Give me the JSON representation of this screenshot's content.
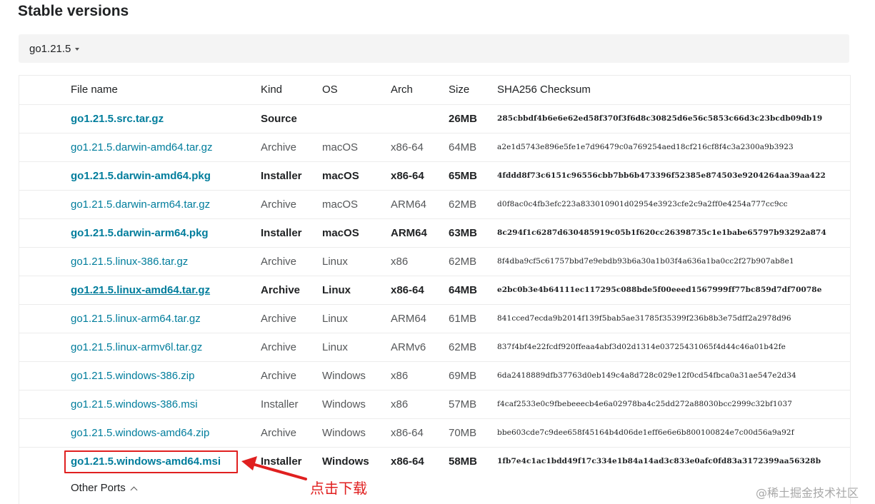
{
  "heading": "Stable versions",
  "version_selector": {
    "value": "go1.21.5"
  },
  "table": {
    "headers": {
      "file": "File name",
      "kind": "Kind",
      "os": "OS",
      "arch": "Arch",
      "size": "Size",
      "checksum": "SHA256 Checksum"
    },
    "rows": [
      {
        "file": "go1.21.5.src.tar.gz",
        "kind": "Source",
        "os": "",
        "arch": "",
        "size": "26MB",
        "checksum": "285cbbdf4b6e6e62ed58f370f3f6d8c30825d6e56c5853c66d3c23bcdb09db19"
      },
      {
        "file": "go1.21.5.darwin-amd64.tar.gz",
        "kind": "Archive",
        "os": "macOS",
        "arch": "x86-64",
        "size": "64MB",
        "checksum": "a2e1d5743e896e5fe1e7d96479c0a769254aed18cf216cf8f4c3a2300a9b3923"
      },
      {
        "file": "go1.21.5.darwin-amd64.pkg",
        "kind": "Installer",
        "os": "macOS",
        "arch": "x86-64",
        "size": "65MB",
        "checksum": "4fddd8f73c6151c96556cbb7bb6b473396f52385e874503e9204264aa39aa422"
      },
      {
        "file": "go1.21.5.darwin-arm64.tar.gz",
        "kind": "Archive",
        "os": "macOS",
        "arch": "ARM64",
        "size": "62MB",
        "checksum": "d0f8ac0c4fb3efc223a833010901d02954e3923cfe2c9a2ff0e4254a777cc9cc"
      },
      {
        "file": "go1.21.5.darwin-arm64.pkg",
        "kind": "Installer",
        "os": "macOS",
        "arch": "ARM64",
        "size": "63MB",
        "checksum": "8c294f1c6287d630485919c05b1f620cc26398735c1e1babe65797b93292a874"
      },
      {
        "file": "go1.21.5.linux-386.tar.gz",
        "kind": "Archive",
        "os": "Linux",
        "arch": "x86",
        "size": "62MB",
        "checksum": "8f4dba9cf5c61757bbd7e9ebdb93b6a30a1b03f4a636a1ba0cc2f27b907ab8e1"
      },
      {
        "file": "go1.21.5.linux-amd64.tar.gz",
        "kind": "Archive",
        "os": "Linux",
        "arch": "x86-64",
        "size": "64MB",
        "checksum": "e2bc0b3e4b64111ec117295c088bde5f00eeed1567999ff77bc859d7df70078e"
      },
      {
        "file": "go1.21.5.linux-arm64.tar.gz",
        "kind": "Archive",
        "os": "Linux",
        "arch": "ARM64",
        "size": "61MB",
        "checksum": "841cced7ecda9b2014f139f5bab5ae31785f35399f236b8b3e75dff2a2978d96"
      },
      {
        "file": "go1.21.5.linux-armv6l.tar.gz",
        "kind": "Archive",
        "os": "Linux",
        "arch": "ARMv6",
        "size": "62MB",
        "checksum": "837f4bf4e22fcdf920ffeaa4abf3d02d1314e03725431065f4d44c46a01b42fe"
      },
      {
        "file": "go1.21.5.windows-386.zip",
        "kind": "Archive",
        "os": "Windows",
        "arch": "x86",
        "size": "69MB",
        "checksum": "6da2418889dfb37763d0eb149c4a8d728c029e12f0cd54fbca0a31ae547e2d34"
      },
      {
        "file": "go1.21.5.windows-386.msi",
        "kind": "Installer",
        "os": "Windows",
        "arch": "x86",
        "size": "57MB",
        "checksum": "f4caf2533e0c9fbebeeecb4e6a02978ba4c25dd272a88030bcc2999c32bf1037"
      },
      {
        "file": "go1.21.5.windows-amd64.zip",
        "kind": "Archive",
        "os": "Windows",
        "arch": "x86-64",
        "size": "70MB",
        "checksum": "bbe603cde7c9dee658f45164b4d06de1eff6e6e6b800100824e7c00d56a9a92f"
      },
      {
        "file": "go1.21.5.windows-amd64.msi",
        "kind": "Installer",
        "os": "Windows",
        "arch": "x86-64",
        "size": "58MB",
        "checksum": "1fb7e4c1ac1bdd49f17c334e1b84a14ad3c833e0afc0fd83a3172399aa56328b"
      }
    ]
  },
  "other_ports_label": "Other Ports",
  "annotation": {
    "text": "点击下载",
    "color": "#e02020"
  },
  "watermark": "@稀土掘金技术社区",
  "colors": {
    "link": "#007d9c",
    "version_bar_bg": "#f4f4f4",
    "annotation_red": "#e02020"
  },
  "icons": {
    "version_caret": "caret-down-icon",
    "other_ports_chevron": "chevron-up-icon",
    "annotation_arrow": "arrow-left-icon"
  }
}
